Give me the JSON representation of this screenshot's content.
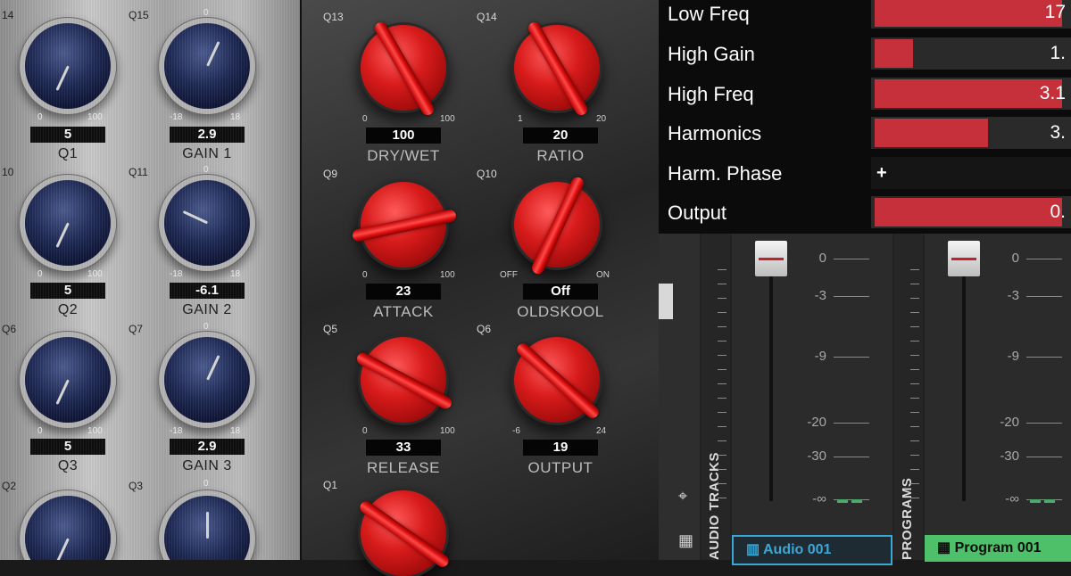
{
  "eq": {
    "rows": [
      {
        "left": {
          "q": "14",
          "min": "0",
          "max": "100",
          "value": "5",
          "name": "Q1"
        },
        "right": {
          "q": "Q15",
          "top": "0",
          "min": "-18",
          "max": "18",
          "value": "2.9",
          "name": "GAIN 1"
        }
      },
      {
        "left": {
          "q": "10",
          "min": "0",
          "max": "100",
          "value": "5",
          "name": "Q2"
        },
        "right": {
          "q": "Q11",
          "top": "0",
          "min": "-18",
          "max": "18",
          "value": "-6.1",
          "name": "GAIN 2"
        }
      },
      {
        "left": {
          "q": "Q6",
          "min": "0",
          "max": "100",
          "value": "5",
          "name": "Q3"
        },
        "right": {
          "q": "Q7",
          "top": "0",
          "min": "-18",
          "max": "18",
          "value": "2.9",
          "name": "GAIN 3"
        }
      },
      {
        "left": {
          "q": "Q2"
        },
        "right": {
          "q": "Q3",
          "top": "0"
        }
      }
    ]
  },
  "comp": {
    "knobs": [
      {
        "q": "Q13",
        "min": "0",
        "max": "100",
        "value": "100",
        "name": "DRY/WET"
      },
      {
        "q": "Q14",
        "min": "1",
        "max": "20",
        "value": "20",
        "name": "RATIO"
      },
      {
        "q": "Q9",
        "min": "0",
        "max": "100",
        "value": "23",
        "name": "ATTACK"
      },
      {
        "q": "Q10",
        "min": "OFF",
        "max": "ON",
        "value": "Off",
        "name": "OLDSKOOL"
      },
      {
        "q": "Q5",
        "min": "0",
        "max": "100",
        "value": "33",
        "name": "RELEASE"
      },
      {
        "q": "Q6",
        "min": "-6",
        "max": "24",
        "value": "19",
        "name": "OUTPUT"
      },
      {
        "q": "Q1"
      }
    ]
  },
  "params": [
    {
      "name": "Low Freq",
      "value": "17",
      "fill": 0.97
    },
    {
      "name": "High Gain",
      "value": "1.",
      "fill": 0.2
    },
    {
      "name": "High Freq",
      "value": "3.1",
      "fill": 0.97
    },
    {
      "name": "Harmonics",
      "value": "3.",
      "fill": 0.59
    },
    {
      "name": "Harm. Phase",
      "sign": "+"
    },
    {
      "name": "Output",
      "value": "0.",
      "fill": 0.97
    }
  ],
  "mixer": {
    "audio_tracks_label": "AUDIO TRACKS",
    "programs_label": "PROGRAMS",
    "db_marks": [
      "0",
      "-3",
      "-9",
      "-20",
      "-30",
      "-∞"
    ],
    "audio_track_name": "Audio 001",
    "program_name": "Program 001",
    "colors": {
      "audio": "#3ba7d6",
      "program": "#4fc06a",
      "meter": "#4ea86a"
    }
  }
}
